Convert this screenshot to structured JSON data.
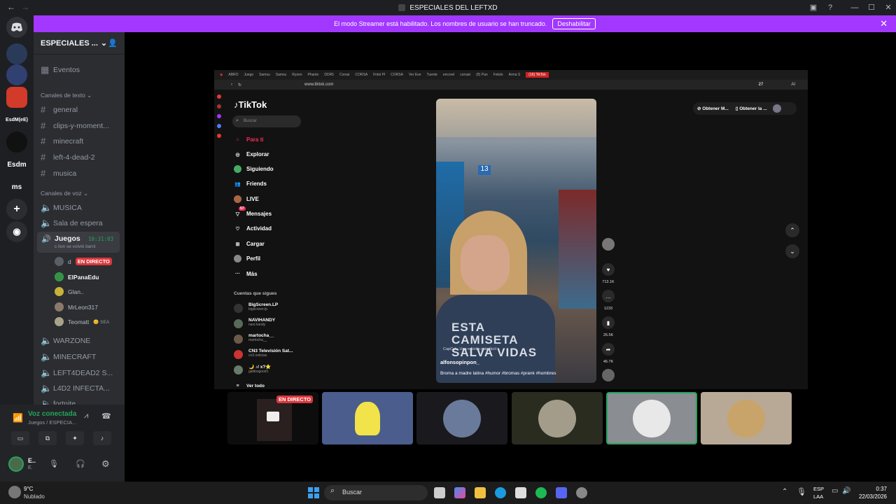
{
  "window": {
    "title": "ESPECIALES DEL LEFTXD"
  },
  "banner": {
    "text": "El modo Streamer está habilitado. Los nombres de usuario se han truncado.",
    "disable_label": "Deshabilitar",
    "close_label": "✕"
  },
  "servers": [
    {
      "label": "EsdM(eE)"
    },
    {
      "label": "Esdm"
    },
    {
      "label": "ms"
    }
  ],
  "guild": {
    "name": "ESPECIALES ...",
    "chevron": "⌄"
  },
  "sidebar": {
    "events_label": "Eventos",
    "text_category": "Canales de texto",
    "text_channels": [
      "general",
      "clips-y-moment...",
      "minecraft",
      "left-4-dead-2",
      "musica"
    ],
    "voice_category": "Canales de voz",
    "voice_channels_top": [
      "MUSICA",
      "Sala de espera"
    ],
    "active_voice": {
      "name": "Juegos",
      "timer": "10:31:03",
      "status": "c lion se volvió barni"
    },
    "voice_users": [
      {
        "name": "d",
        "badge": "EN DIRECTO"
      },
      {
        "name": "ElPanaEdu"
      },
      {
        "name": "Glan.."
      },
      {
        "name": "MrLeon317"
      },
      {
        "name": "Teomatt",
        "activity": "😊 SEA"
      }
    ],
    "voice_channels_bottom": [
      "WARZONE",
      "MINECRAFT",
      "LEFT4DEAD2 S...",
      "L4D2 INFECTA...",
      "fortnite"
    ]
  },
  "voice_panel": {
    "status": "Voz conectada",
    "channel": "Juegos / ESPECIA...",
    "user_name": "E..",
    "user_sub": "E."
  },
  "browser": {
    "url": "www.tiktok.com",
    "tabs": [
      "ABRO",
      "Juego",
      "Samsu",
      "Samsu",
      "Ryzen",
      "Phanto",
      "DDR5",
      "Corsai",
      "CORSA",
      "Fntol Pl",
      "CORSA",
      "Ver Eve",
      "Tuente",
      "encorel",
      "corsair",
      "(8) Pan",
      "Fekdo",
      "Arma S",
      "(16) TikTok"
    ],
    "tab_count": "27",
    "ai_label": "AI"
  },
  "tiktok": {
    "logo": "TikTok",
    "search_placeholder": "Buscar",
    "nav": [
      "Para ti",
      "Explorar",
      "Siguiendo",
      "Friends",
      "LIVE",
      "Mensajes",
      "Actividad",
      "Cargar",
      "Perfil",
      "Más"
    ],
    "messages_badge": "57",
    "following_title": "Cuentas que sigues",
    "accounts": [
      {
        "name": "BigScreen.LP",
        "user": "bigscreen.lp"
      },
      {
        "name": "NAVIHANDY",
        "user": "navi.handy"
      },
      {
        "name": "martocha__",
        "user": "martocha__"
      },
      {
        "name": "CN3 Televisión Sat...",
        "user": "cn3.noticias"
      },
      {
        "name": "🌙 ♪/ x?⭐",
        "user": "galitosgood1"
      }
    ],
    "see_all": "Ver todo",
    "top_right": [
      "Obtener M...",
      "Obtener la ..."
    ],
    "video": {
      "shirt_text": "ESTA CAMISETA SALVA VIDAS",
      "aisle": "13",
      "capcut": "CapCut · Una edición más fácil",
      "author": "alfonsopinpon_",
      "caption": "Broma a madre latina #humor #bromas #prank #hombres"
    },
    "likes": "713.1K",
    "comments": "1233",
    "saves": "26.5K",
    "shares": "46.7K"
  },
  "stream_tiles": {
    "live_badge": "EN DIRECTO"
  },
  "taskbar": {
    "weather_temp": "9°C",
    "weather_desc": "Nublado",
    "search_label": "Buscar",
    "lang": "ESP",
    "lang_sub": "LAA",
    "time": "0:37",
    "date": "22/03/2026"
  },
  "colors": {
    "accent": "#a238ff",
    "live": "#da373c",
    "voice_green": "#23a55a",
    "tiktok_red": "#fe2c55"
  }
}
